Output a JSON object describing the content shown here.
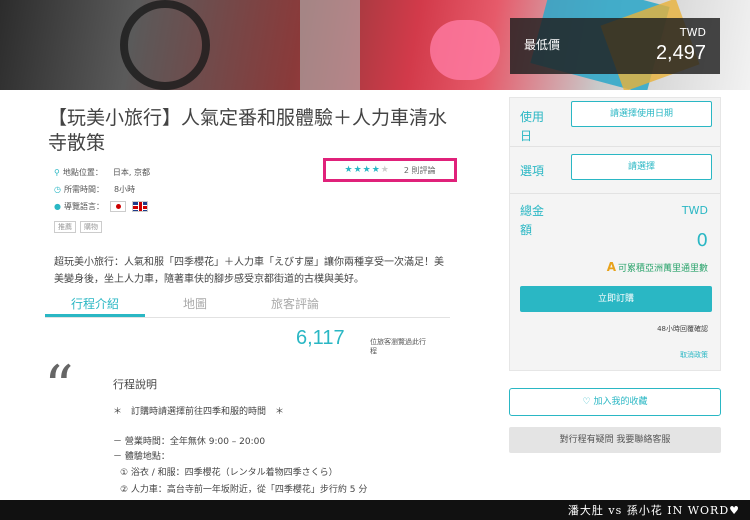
{
  "hero": {
    "price_label": "最低價",
    "currency": "TWD",
    "price": "2,497"
  },
  "product": {
    "title": "【玩美小旅行】人氣定番和服體驗＋人力車清水寺散策",
    "location_label": "地點位置：",
    "location_value": "日本, 京都",
    "duration_label": "所需時間：",
    "duration_value": "8小時",
    "language_label": "導覽語言：",
    "languages": [
      "japan-flag-icon",
      "uk-flag-icon"
    ],
    "tags": [
      "推薦",
      "購物"
    ],
    "rating_stars": 4,
    "rating_max": 5,
    "review_count": "2 則評論",
    "description": "超玩美小旅行：人氣和服「四季櫻花」＋人力車「えびす屋」讓你兩種享受一次滿足！美美變身後，坐上人力車，隨著車伕的腳步感受京都街道的古樸與美好。"
  },
  "tabs": [
    {
      "label": "行程介紹",
      "active": true
    },
    {
      "label": "地圖",
      "active": false
    },
    {
      "label": "旅客評論",
      "active": false
    }
  ],
  "stats": {
    "number": "6,117",
    "label": "位旅客瀏覽過此行程"
  },
  "itinerary": {
    "section_title": "行程說明",
    "lines": [
      "＊　訂購時請選擇前往四季和服的時間　＊",
      "－ 營業時間：全年無休 9:00 – 20:00",
      "－ 體驗地點：",
      "① 浴衣 / 和服：四季櫻花（レンタル着物四季さくら）",
      "② 人力車：高台寺前一年坂附近，從「四季櫻花」步行約 5 分"
    ]
  },
  "booking": {
    "date_label": "使用日",
    "date_button": "請選擇使用日期",
    "option_label": "選項",
    "option_button": "請選擇",
    "total_label": "總金額",
    "total_currency": "TWD",
    "total_value": "0",
    "miles_text": "可累積亞洲萬里通里數",
    "book_button": "立即訂購",
    "confirm_text": "48小時回覆確認",
    "cancel_link": "取消政策"
  },
  "actions": {
    "favorite_button": "加入我的收藏",
    "contact_button": "對行程有疑問 我要聯絡客服"
  },
  "footer": {
    "watermark": "潘大肚 vs 孫小花 IN WORD♥"
  },
  "colors": {
    "accent": "#2ab7c4",
    "rating_border": "#e0217a"
  }
}
